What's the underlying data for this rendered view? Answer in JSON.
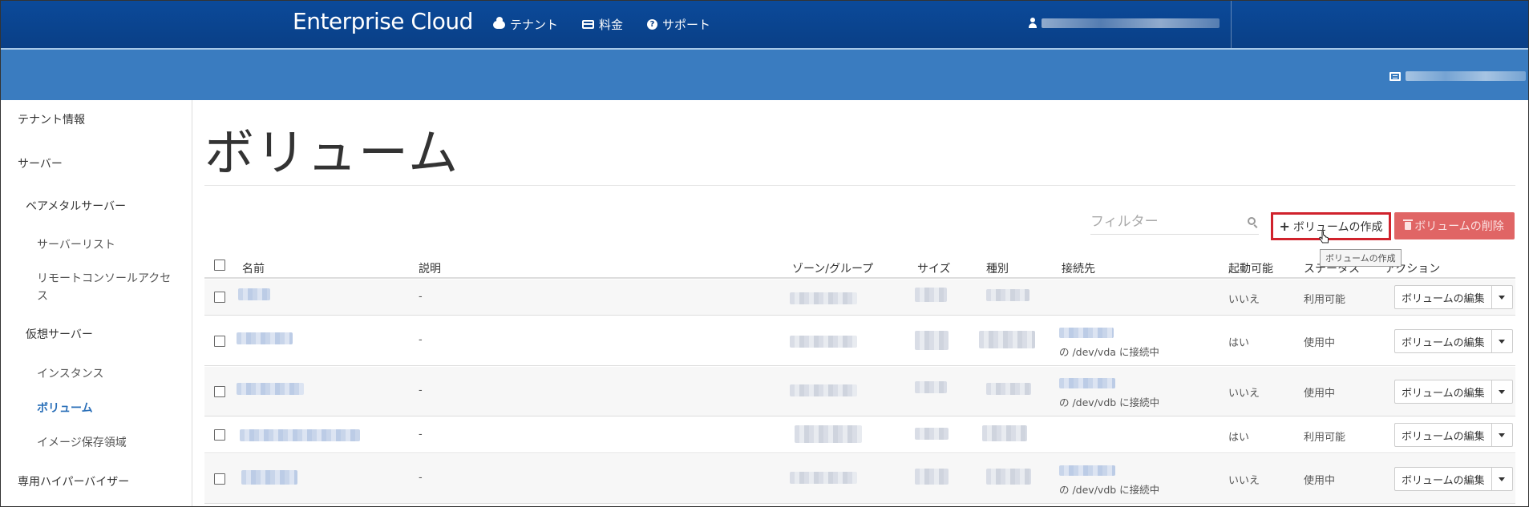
{
  "header": {
    "brand": "Enterprise Cloud",
    "nav": [
      {
        "label": "テナント",
        "icon": "cloud-icon"
      },
      {
        "label": "料金",
        "icon": "credit-card-icon"
      },
      {
        "label": "サポート",
        "icon": "help-icon"
      }
    ]
  },
  "sidebar": {
    "items": [
      {
        "label": "テナント情報"
      },
      {
        "label": "サーバー"
      },
      {
        "label": "ベアメタルサーバー"
      },
      {
        "label": "サーバーリスト"
      },
      {
        "label": "リモートコンソールアクセス"
      },
      {
        "label": "仮想サーバー"
      },
      {
        "label": "インスタンス"
      },
      {
        "label": "ボリューム"
      },
      {
        "label": "イメージ保存領域"
      },
      {
        "label": "専用ハイパーバイザー"
      }
    ]
  },
  "main": {
    "title": "ボリューム",
    "filter_placeholder": "フィルター",
    "create_button": "ボリュームの作成",
    "delete_button": "ボリュームの削除",
    "tooltip": "ボリュームの作成",
    "columns": [
      "名前",
      "説明",
      "ゾーン/グループ",
      "サイズ",
      "種別",
      "接続先",
      "起動可能",
      "ステータス",
      "アクション"
    ],
    "rows": [
      {
        "description": "-",
        "connection": "",
        "bootable": "いいえ",
        "status": "利用可能",
        "action": "ボリュームの編集"
      },
      {
        "description": "-",
        "connection": "の /dev/vda に接続中",
        "bootable": "はい",
        "status": "使用中",
        "action": "ボリュームの編集"
      },
      {
        "description": "-",
        "connection": "の /dev/vdb に接続中",
        "bootable": "いいえ",
        "status": "使用中",
        "action": "ボリュームの編集"
      },
      {
        "description": "-",
        "connection": "",
        "bootable": "はい",
        "status": "利用可能",
        "action": "ボリュームの編集"
      },
      {
        "description": "-",
        "connection": "の /dev/vdb に接続中",
        "bootable": "いいえ",
        "status": "使用中",
        "action": "ボリュームの編集"
      }
    ]
  },
  "colors": {
    "topbar": "#0a3f86",
    "subbar": "#3a7cc0",
    "active_link": "#2a6fb8",
    "danger": "#e06565",
    "highlight": "#d0222c"
  }
}
